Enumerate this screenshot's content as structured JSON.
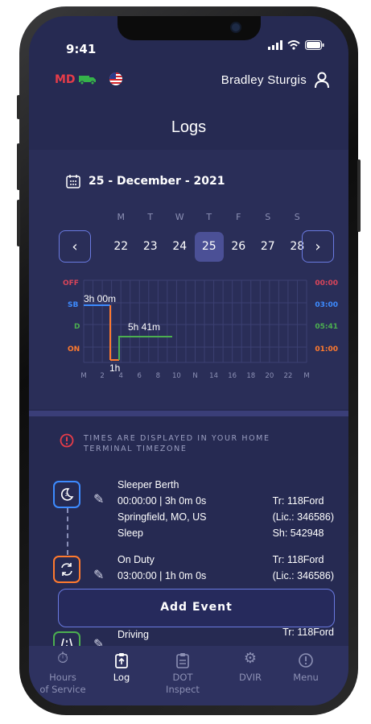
{
  "status": {
    "time": "9:41"
  },
  "header": {
    "state_code": "MD",
    "user_name": "Bradley Sturgis",
    "title": "Logs"
  },
  "calendar": {
    "date_label": "25 - December - 2021",
    "day_names": [
      "M",
      "T",
      "W",
      "T",
      "F",
      "S",
      "S"
    ],
    "dates": [
      "22",
      "23",
      "24",
      "25",
      "26",
      "27",
      "28"
    ],
    "selected_index": 3
  },
  "graph": {
    "status_labels": [
      "OFF",
      "SB",
      "D",
      "ON"
    ],
    "status_colors": [
      "#d9455a",
      "#3d8bff",
      "#4caf50",
      "#ff7a2e"
    ],
    "totals": [
      "00:00",
      "03:00",
      "05:41",
      "01:00"
    ],
    "x_ticks": [
      "M",
      "2",
      "4",
      "6",
      "8",
      "10",
      "N",
      "14",
      "16",
      "18",
      "20",
      "22",
      "M"
    ],
    "annotations": [
      "3h 00m",
      "5h 41m",
      "1h"
    ]
  },
  "notice": "TIMES ARE DISPLAYED IN YOUR HOME TERMINAL TIMEZONE",
  "events": [
    {
      "icon": "moon-icon",
      "color": "#3d8bff",
      "lines": [
        "Sleeper Berth",
        "00:00:00 | 3h 0m 0s",
        "Springfield, MO, US",
        "Sleep"
      ],
      "right": [
        "Tr: 118Ford",
        "(Lic.: 346586)",
        "Sh: 542948"
      ]
    },
    {
      "icon": "duty-icon",
      "color": "#ff7a2e",
      "lines": [
        "On Duty",
        "03:00:00 | 1h 0m 0s"
      ],
      "right": [
        "Tr: 118Ford",
        "(Lic.: 346586)"
      ]
    },
    {
      "icon": "road-icon",
      "color": "#4caf50",
      "lines": [
        "Driving"
      ],
      "right": [
        "Tr: 118Ford"
      ]
    }
  ],
  "add_event_label": "Add Event",
  "tabs": [
    {
      "label": "Hours\nof Service",
      "l1": "Hours",
      "l2": "of Service"
    },
    {
      "label": "Log",
      "l1": "Log",
      "l2": ""
    },
    {
      "label": "DOT Inspect",
      "l1": "DOT",
      "l2": "Inspect"
    },
    {
      "label": "DVIR",
      "l1": "DVIR",
      "l2": ""
    },
    {
      "label": "Menu",
      "l1": "Menu",
      "l2": ""
    }
  ],
  "active_tab": 1
}
